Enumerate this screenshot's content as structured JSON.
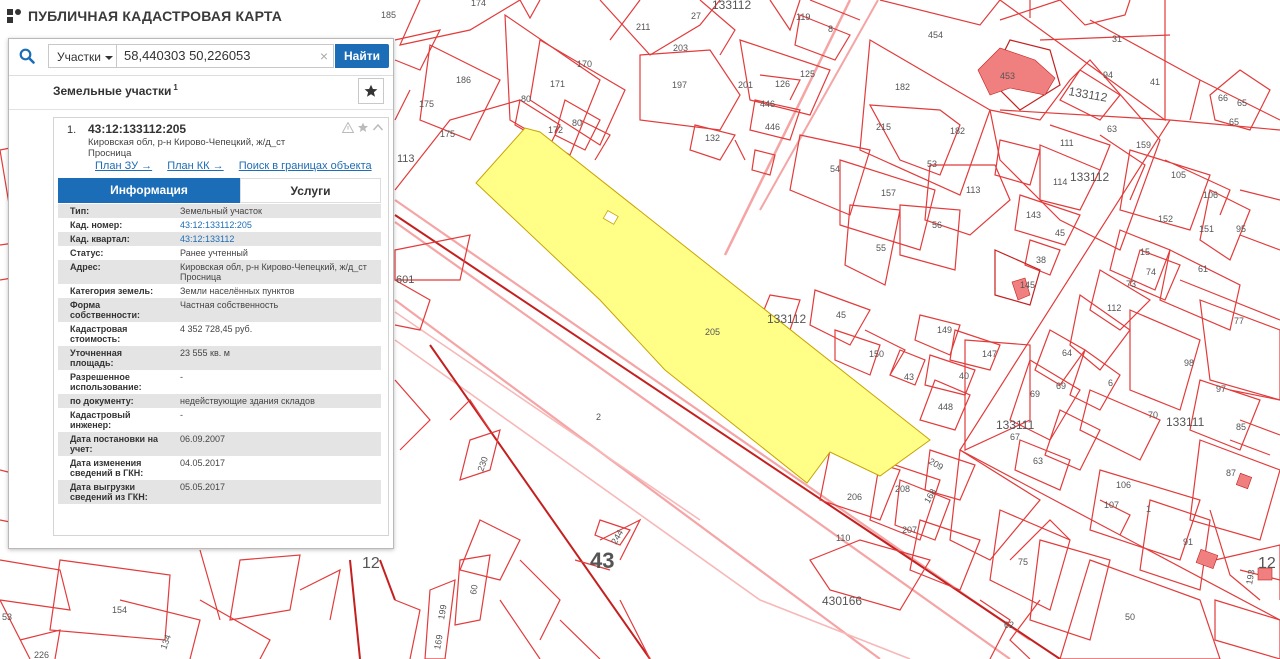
{
  "app": {
    "title": "ПУБЛИЧНАЯ КАДАСТРОВАЯ КАРТА"
  },
  "search": {
    "type_label": "Участки",
    "query_value": "58,440303 50,226053",
    "clear_glyph": "×",
    "submit_label": "Найти"
  },
  "results": {
    "title": "Земельные участки",
    "count": "1"
  },
  "result_card": {
    "index": "1.",
    "cad_number": "43:12:133112:205",
    "address": "Кировская обл, р-н Кирово-Чепецкий, ж/д_ст Просница",
    "links": [
      "План ЗУ →",
      "План КК →",
      "Поиск в границах объекта →"
    ],
    "tabs": [
      "Информация",
      "Услуги"
    ],
    "rows": [
      {
        "k": "Тип:",
        "v": "Земельный участок"
      },
      {
        "k": "Кад. номер:",
        "v": "43:12:133112:205"
      },
      {
        "k": "Кад. квартал:",
        "v": "43:12:133112"
      },
      {
        "k": "Статус:",
        "v": "Ранее учтенный"
      },
      {
        "k": "Адрес:",
        "v": "Кировская обл, р-н Кирово-Чепецкий, ж/д_ст Просница"
      },
      {
        "k": "Категория земель:",
        "v": "Земли населённых пунктов"
      },
      {
        "k": "Форма собственности:",
        "v": "Частная собственность"
      },
      {
        "k": "Кадастровая стоимость:",
        "v": "4 352 728,45 руб."
      },
      {
        "k": "Уточненная площадь:",
        "v": "23 555 кв. м"
      },
      {
        "k": "Разрешенное использование:",
        "v": "-"
      },
      {
        "k": "по документу:",
        "v": "недействующие здания складов"
      },
      {
        "k": "Кадастровый инженер:",
        "v": "-"
      },
      {
        "k": "Дата постановки на учет:",
        "v": "06.09.2007"
      },
      {
        "k": "Дата изменения сведений в ГКН:",
        "v": "04.05.2017"
      },
      {
        "k": "Дата выгрузки сведений из ГКН:",
        "v": "05.05.2017"
      }
    ]
  },
  "map": {
    "labels": {
      "sel205": "205",
      "q133112a": "133112",
      "q133112b": "133112",
      "q133112c": "133112",
      "q133112d": "133112",
      "q133111a": "133111",
      "q133111b": "133111",
      "q430166": "430166",
      "d43": "43",
      "d12": "12",
      "d12r": "12",
      "p454": "454",
      "p453": "453",
      "p31": "31",
      "p94": "94",
      "p41": "41",
      "p182a": "182",
      "p182b": "182",
      "p185": "185",
      "p174": "174",
      "p211": "211",
      "p27": "27",
      "p119": "119",
      "p8": "8",
      "p170": "170",
      "p186": "186",
      "p171": "171",
      "p80a": "80",
      "p80b": "80",
      "p172": "172",
      "p197": "197",
      "p203": "203",
      "p201": "201",
      "p446a": "446",
      "p446b": "446",
      "p126": "126",
      "p125": "125",
      "p132": "132",
      "p175a": "175",
      "p175b": "175",
      "p113a": "113",
      "p113b": "113",
      "p215": "215",
      "p53": "53",
      "p54": "54",
      "p157": "157",
      "p56": "56",
      "p55": "55",
      "p111": "111",
      "p114": "114",
      "p63": "63",
      "p159": "159",
      "p143": "143",
      "p45a": "45",
      "p45b": "45",
      "p38": "38",
      "p145": "145",
      "p66": "66",
      "p65": "65",
      "p65b": "65",
      "p105": "105",
      "p106": "106",
      "p152": "152",
      "p151": "151",
      "p95": "95",
      "p15": "15",
      "p74": "74",
      "p73": "73",
      "p61": "61",
      "p112": "112",
      "p77": "77",
      "p98": "98",
      "p149": "149",
      "p150": "150",
      "p147": "147",
      "p40": "40",
      "p43": "43",
      "p448": "448",
      "p64": "64",
      "p69a": "69",
      "p69b": "69",
      "p6": "6",
      "p70": "70",
      "p97": "97",
      "p67": "67",
      "p63b": "63",
      "p601": "601",
      "p2": "2",
      "p230": "230",
      "p209": "209",
      "p206": "206",
      "p208": "208",
      "p168": "168",
      "p207": "207",
      "p110": "110",
      "p244": "244",
      "p154": "154",
      "p134": "134",
      "p199": "199",
      "p60": "60",
      "p169": "169",
      "p75": "75",
      "p62": "62",
      "p50": "50",
      "p87": "87",
      "p91": "91",
      "p106b": "106",
      "p107": "107",
      "p1": "1",
      "p53b": "53",
      "p106c": "106",
      "p226": "226",
      "p35": "35",
      "p85": "85",
      "p193": "193"
    }
  },
  "colors": {
    "boundary": "#e23b3b",
    "selected_fill": "#ffff88",
    "selected_stroke": "#c9a400",
    "building_fill": "#f07f7f",
    "accent": "#1a6db6"
  }
}
